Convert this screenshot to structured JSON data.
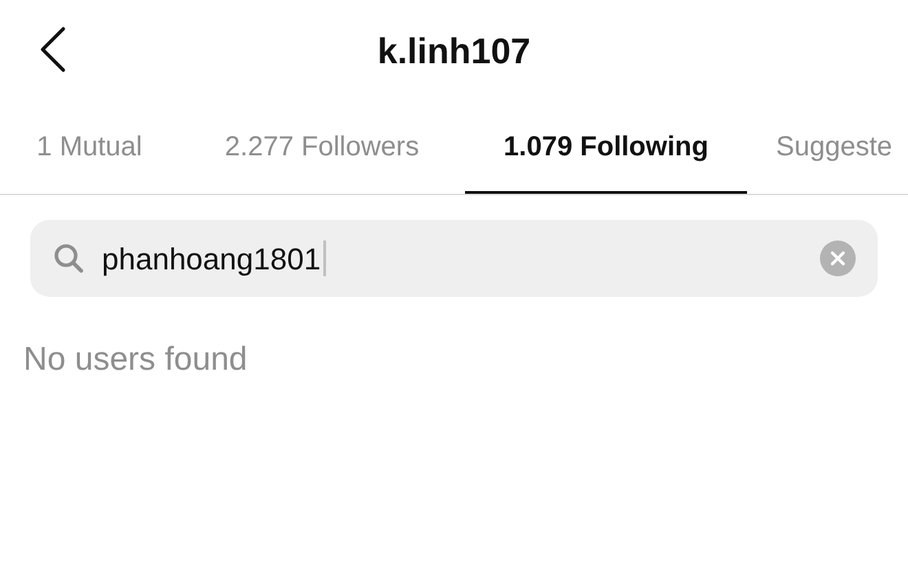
{
  "header": {
    "title": "k.linh107"
  },
  "tabs": [
    {
      "label": "1 Mutual",
      "selected": false
    },
    {
      "label": "2.277 Followers",
      "selected": false
    },
    {
      "label": "1.079 Following",
      "selected": true
    },
    {
      "label": "Suggeste",
      "selected": false
    }
  ],
  "search": {
    "value": "phanhoang1801"
  },
  "message": "No users found"
}
